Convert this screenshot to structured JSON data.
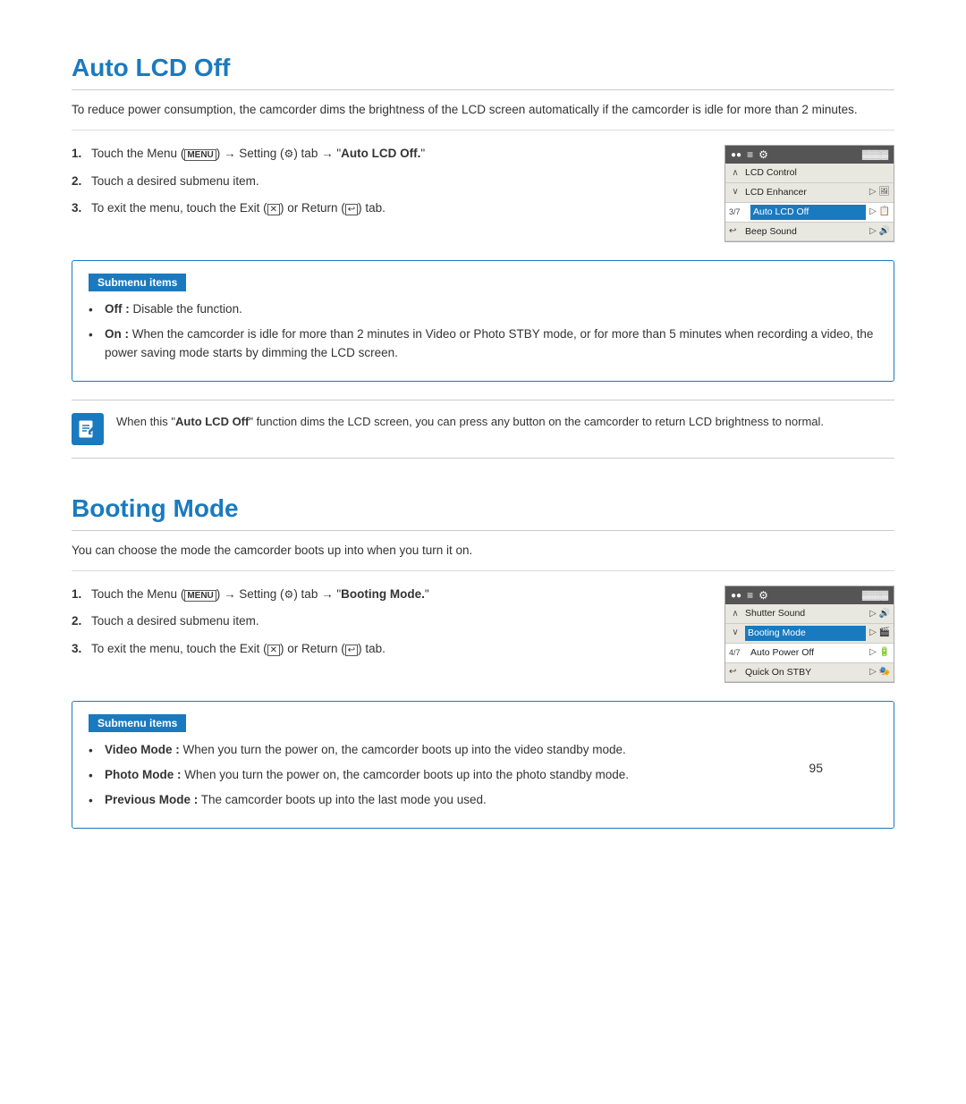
{
  "section1": {
    "title": "Auto LCD Off",
    "intro": "To reduce power consumption, the camcorder dims the brightness of the LCD screen automatically if the camcorder is idle for more than 2 minutes.",
    "steps": [
      {
        "num": "1.",
        "text_before": "Touch the Menu (",
        "menu_label": "MENU",
        "text_middle": ") → Setting (",
        "setting_label": "⚙",
        "text_after": ") tab → \"",
        "highlight": "Auto LCD Off",
        "text_end": ".\""
      },
      {
        "num": "2.",
        "text": "Touch a desired submenu item."
      },
      {
        "num": "3.",
        "text_before": "To exit the menu, touch the Exit (",
        "exit_label": "✕",
        "text_middle": ") or Return (",
        "return_label": "↩",
        "text_end": ") tab."
      }
    ],
    "menu_ui": {
      "header_icons": [
        "●●",
        "≡",
        "⚙",
        "🔋"
      ],
      "rows": [
        {
          "nav": "∧",
          "label": "LCD Control",
          "highlighted": false,
          "icon": "",
          "page": ""
        },
        {
          "nav": "∨",
          "label": "LCD Enhancer",
          "highlighted": false,
          "icon": "▷ 🖼",
          "page": ""
        },
        {
          "nav": "",
          "label": "Auto LCD Off",
          "highlighted": true,
          "icon": "▷ 📋",
          "page": "3/7"
        },
        {
          "nav": "↩",
          "label": "Beep Sound",
          "highlighted": false,
          "icon": "▷ 🔊",
          "page": ""
        }
      ]
    },
    "submenu": {
      "title": "Submenu items",
      "items": [
        {
          "key": "Off",
          "separator": " : ",
          "value": "Disable the function."
        },
        {
          "key": "On",
          "separator": " : ",
          "value": "When the camcorder is idle for more than 2 minutes in Video or Photo STBY mode, or for more than 5 minutes when recording a video, the power saving mode starts by dimming the LCD screen."
        }
      ]
    },
    "note": {
      "text_before": "When this \"",
      "bold": "Auto LCD Off",
      "text_after": "\" function dims the LCD screen, you can press any button on the camcorder to return LCD brightness to normal."
    }
  },
  "section2": {
    "title": "Booting Mode",
    "intro": "You can choose the mode the camcorder boots up into when you turn it on.",
    "steps": [
      {
        "num": "1.",
        "text_before": "Touch the Menu (",
        "menu_label": "MENU",
        "text_middle": ") → Setting (",
        "setting_label": "⚙",
        "text_after": ") tab → \"",
        "highlight": "Booting Mode",
        "text_end": ".\""
      },
      {
        "num": "2.",
        "text": "Touch a desired submenu item."
      },
      {
        "num": "3.",
        "text_before": "To exit the menu, touch the Exit (",
        "exit_label": "✕",
        "text_middle": ") or Return (",
        "return_label": "↩",
        "text_end": ") tab."
      }
    ],
    "menu_ui": {
      "header_icons": [
        "●●",
        "≡",
        "⚙",
        "🔋"
      ],
      "rows": [
        {
          "nav": "∧",
          "label": "Shutter Sound",
          "highlighted": false,
          "icon": "▷ 🔊",
          "page": ""
        },
        {
          "nav": "∨",
          "label": "Booting Mode",
          "highlighted": true,
          "icon": "▷ 🎬",
          "page": ""
        },
        {
          "nav": "",
          "label": "Auto Power Off",
          "highlighted": false,
          "icon": "▷ 🔋",
          "page": "4/7"
        },
        {
          "nav": "↩",
          "label": "Quick On STBY",
          "highlighted": false,
          "icon": "▷ 🎭",
          "page": ""
        }
      ]
    },
    "submenu": {
      "title": "Submenu items",
      "items": [
        {
          "key": "Video Mode",
          "separator": " : ",
          "value": "When you turn the power on, the camcorder boots up into the video standby mode."
        },
        {
          "key": "Photo Mode",
          "separator": " : ",
          "value": "When you turn the power on, the camcorder boots up into the photo standby mode."
        },
        {
          "key": "Previous Mode",
          "separator": " : ",
          "value": "The camcorder boots up into the last mode you used."
        }
      ]
    }
  },
  "page_number": "95"
}
